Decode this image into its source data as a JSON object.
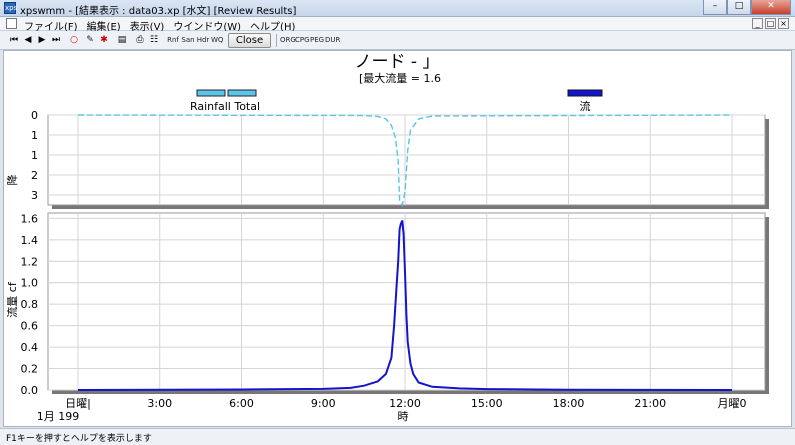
{
  "window": {
    "title": "xpswmm - [結果表示 : data03.xp [水文] [Review Results]",
    "app_icon_label": "xps"
  },
  "menu": [
    {
      "label": "ファイル(F)"
    },
    {
      "label": "編集(E)"
    },
    {
      "label": "表示(V)"
    },
    {
      "label": "ウインドウ(W)"
    },
    {
      "label": "ヘルプ(H)"
    }
  ],
  "toolbar": {
    "close_label": "Close",
    "buttons_left": [
      "Rnf",
      "San",
      "Hdr",
      "WQ"
    ],
    "buttons_right": [
      "ORG",
      "CPG",
      "PEG",
      "DUR"
    ]
  },
  "status": {
    "text": "F1キーを押すとヘルプを表示します"
  },
  "chart_data": {
    "type": "line",
    "title": "ノード - 」",
    "subtitle": "[最大流量 = 1.6",
    "xlabel": "時",
    "x_ticks": [
      "日曜|",
      "3:00",
      "6:00",
      "9:00",
      "12:00",
      "15:00",
      "18:00",
      "21:00",
      "月曜0"
    ],
    "x_sublabel": "1月 199",
    "xlim_hours": [
      0,
      24
    ],
    "grid": true,
    "legend_placement": "top",
    "panels": [
      {
        "name": "rainfall",
        "ylabel": "降",
        "yticks": [
          "0",
          "1",
          "1",
          "2",
          "3"
        ],
        "ylim": [
          0,
          3.5
        ],
        "inverted": true,
        "series": [
          {
            "name": "Rainfall Total",
            "color": "#5bc5e8",
            "dashed": true,
            "x": [
              0,
              10.5,
              11.0,
              11.3,
              11.5,
              11.65,
              11.75,
              11.8,
              11.9,
              12.0,
              12.1,
              12.2,
              12.5,
              13.0,
              24
            ],
            "y": [
              0,
              0.02,
              0.06,
              0.15,
              0.4,
              0.9,
              1.8,
              3.3,
              3.5,
              3.0,
              1.4,
              0.6,
              0.15,
              0.04,
              0
            ]
          }
        ]
      },
      {
        "name": "flow",
        "ylabel": "流量 cf",
        "yticks": [
          "0.0",
          "0.2",
          "0.4",
          "0.6",
          "0.8",
          "1.0",
          "1.2",
          "1.4",
          "1.6"
        ],
        "ylim": [
          0,
          1.65
        ],
        "series": [
          {
            "name": "流",
            "color": "#1414cc",
            "x": [
              0,
              6,
              9,
              10,
              10.5,
              11.0,
              11.3,
              11.5,
              11.6,
              11.7,
              11.75,
              11.8,
              11.85,
              11.9,
              11.95,
              12.0,
              12.05,
              12.1,
              12.2,
              12.3,
              12.5,
              13.0,
              14.0,
              15.0,
              18.0,
              24.0
            ],
            "y": [
              0,
              0.005,
              0.01,
              0.02,
              0.04,
              0.08,
              0.15,
              0.3,
              0.6,
              1.0,
              1.2,
              1.5,
              1.55,
              1.58,
              1.45,
              1.1,
              0.7,
              0.45,
              0.25,
              0.15,
              0.07,
              0.03,
              0.015,
              0.008,
              0.003,
              0
            ]
          }
        ]
      }
    ]
  }
}
